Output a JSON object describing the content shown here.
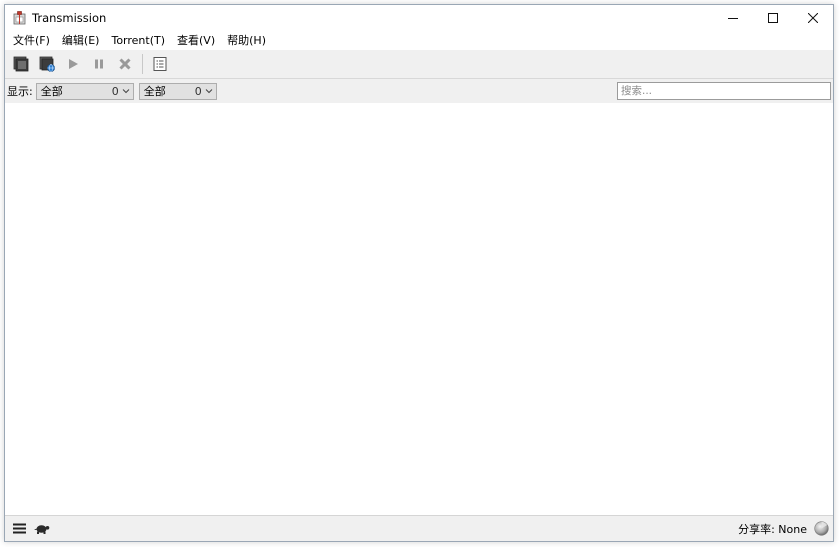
{
  "window": {
    "title": "Transmission"
  },
  "menu": {
    "items": [
      {
        "label": "文件(F)"
      },
      {
        "label": "编辑(E)"
      },
      {
        "label": "Torrent(T)"
      },
      {
        "label": "查看(V)"
      },
      {
        "label": "帮助(H)"
      }
    ]
  },
  "filter": {
    "label": "显示:",
    "activity": {
      "value": "全部",
      "count": "0"
    },
    "tracker": {
      "value": "全部",
      "count": "0"
    },
    "search_placeholder": "搜索..."
  },
  "status": {
    "ratio_label": "分享率: None"
  },
  "colors": {
    "toolbar_bg": "#f0f0f0",
    "icon_dark": "#3c3c3c",
    "icon_disabled": "#9a9a9a",
    "window_border": "#9aa7b5"
  }
}
